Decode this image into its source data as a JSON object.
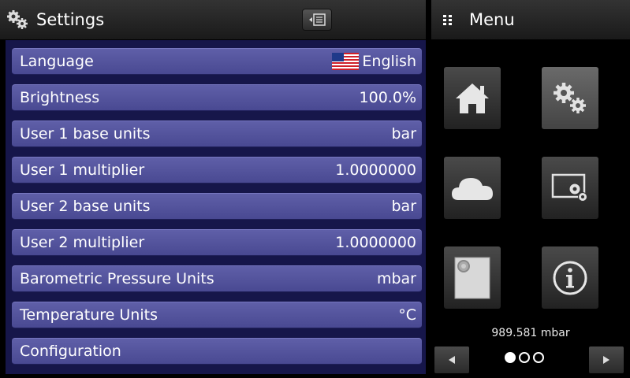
{
  "settings": {
    "title": "Settings",
    "rows": [
      {
        "label": "Language",
        "value": "English",
        "flag": "us-flag-icon"
      },
      {
        "label": "Brightness",
        "value": "100.0%"
      },
      {
        "label": "User 1 base units",
        "value": "bar"
      },
      {
        "label": "User 1 multiplier",
        "value": "1.0000000"
      },
      {
        "label": "User 2 base units",
        "value": "bar"
      },
      {
        "label": "User 2 multiplier",
        "value": "1.0000000"
      },
      {
        "label": "Barometric Pressure Units",
        "value": "mbar"
      },
      {
        "label": "Temperature Units",
        "value": "°C"
      },
      {
        "label": "Configuration",
        "value": ""
      }
    ]
  },
  "menu": {
    "title": "Menu",
    "buttons": [
      {
        "icon": "home-icon",
        "active": false
      },
      {
        "icon": "settings-gears-icon",
        "active": true
      },
      {
        "icon": "cloud-icon",
        "active": false
      },
      {
        "icon": "display-settings-icon",
        "active": false
      },
      {
        "icon": "sensor-module-icon",
        "active": false
      },
      {
        "icon": "info-icon",
        "active": false
      }
    ],
    "barometric_reading": "989.581 mbar",
    "page_current": 1,
    "page_count": 3
  },
  "colors": {
    "row_accent": "#5252a0",
    "list_background": "#16164a"
  }
}
